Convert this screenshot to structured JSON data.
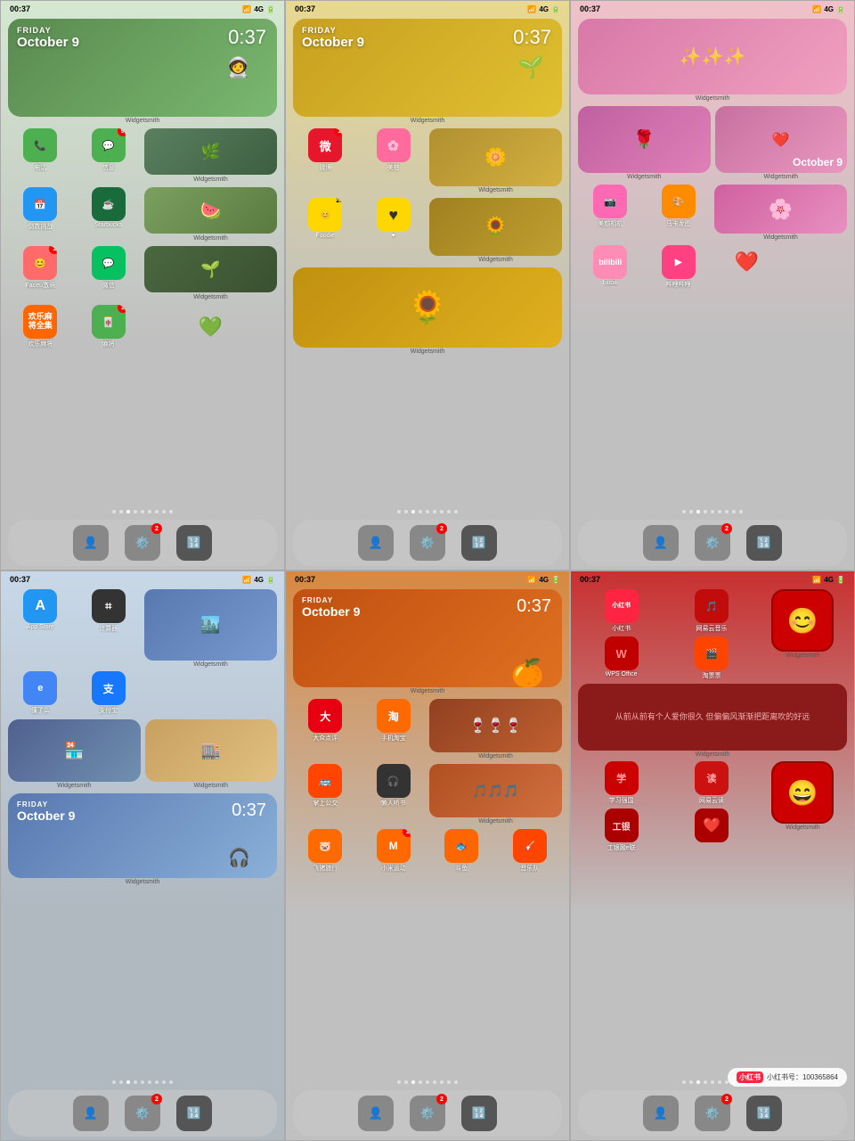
{
  "phones": [
    {
      "id": "phone-1",
      "theme": "green",
      "status": {
        "time": "00:37",
        "signal": "4G"
      },
      "widget_clock": "0:37",
      "widget_day": "FRIDAY",
      "widget_date": "October 9",
      "apps": [
        {
          "name": "电话",
          "bg": "#4CAF50",
          "icon": "📞",
          "badge": ""
        },
        {
          "name": "信息",
          "bg": "#4CAF50",
          "icon": "💬",
          "badge": "9"
        },
        {
          "name": "",
          "bg": "transparent",
          "icon": "",
          "badge": ""
        },
        {
          "name": "",
          "bg": "transparent",
          "icon": "",
          "badge": ""
        },
        {
          "name": "倒数挑战",
          "bg": "#2196F3",
          "icon": "📅",
          "badge": ""
        },
        {
          "name": "Starbucks",
          "bg": "#1a6b3c",
          "icon": "☕",
          "badge": ""
        },
        {
          "name": "",
          "bg": "transparent",
          "icon": "",
          "badge": ""
        },
        {
          "name": "",
          "bg": "transparent",
          "icon": "",
          "badge": ""
        },
        {
          "name": "Faceu激萌",
          "bg": "#FF6B6B",
          "icon": "😊",
          "badge": "1"
        },
        {
          "name": "微信",
          "bg": "#07C160",
          "icon": "💬",
          "badge": ""
        },
        {
          "name": "",
          "bg": "transparent",
          "icon": "",
          "badge": ""
        },
        {
          "name": "",
          "bg": "transparent",
          "icon": "",
          "badge": ""
        },
        {
          "name": "欢乐麻将",
          "bg": "#FF6600",
          "icon": "🀄",
          "badge": ""
        },
        {
          "name": "麻将",
          "bg": "#4CAF50",
          "icon": "🀄",
          "badge": "1"
        },
        {
          "name": "",
          "bg": "transparent",
          "icon": "",
          "badge": ""
        },
        {
          "name": "",
          "bg": "transparent",
          "icon": "",
          "badge": ""
        }
      ],
      "widgetsmith_labels": [
        "Widgetsmith",
        "Widgetsmith",
        "Widgetsmith"
      ],
      "dots": [
        false,
        false,
        true,
        false,
        false,
        false,
        false,
        false,
        false
      ],
      "dock": [
        {
          "icon": "👤",
          "bg": "#888",
          "badge": ""
        },
        {
          "icon": "⚙️",
          "bg": "#888",
          "badge": "2"
        },
        {
          "icon": "🔢",
          "bg": "#555",
          "badge": ""
        }
      ]
    },
    {
      "id": "phone-2",
      "theme": "yellow",
      "status": {
        "time": "00:37",
        "signal": "4G"
      },
      "widget_clock": "0:37",
      "widget_day": "FRIDAY",
      "widget_date": "October 9",
      "apps": [
        {
          "name": "微博",
          "bg": "#E6162D",
          "icon": "微",
          "badge": "1"
        },
        {
          "name": "美柚",
          "bg": "#FF6B9D",
          "icon": "🌸",
          "badge": ""
        },
        {
          "name": "",
          "bg": "transparent",
          "icon": "",
          "badge": ""
        },
        {
          "name": "",
          "bg": "transparent",
          "icon": "",
          "badge": ""
        },
        {
          "name": "Foodie",
          "bg": "#FFD700",
          "icon": "😊",
          "badge": ""
        },
        {
          "name": "♥",
          "bg": "#FFD700",
          "icon": "♥",
          "badge": "20"
        }
      ],
      "widgetsmith_labels": [
        "Widgetsmith",
        "Widgetsmith",
        "Widgetsmith"
      ],
      "dots": [
        false,
        false,
        true,
        false,
        false,
        false,
        false,
        false,
        false
      ],
      "dock": [
        {
          "icon": "👤",
          "bg": "#888",
          "badge": ""
        },
        {
          "icon": "⚙️",
          "bg": "#888",
          "badge": "2"
        },
        {
          "icon": "🔢",
          "bg": "#555",
          "badge": ""
        }
      ]
    },
    {
      "id": "phone-3",
      "theme": "pink",
      "status": {
        "time": "00:37",
        "signal": "4G"
      },
      "widget_clock": "",
      "widget_day": "",
      "widget_date": "October 9",
      "apps": [
        {
          "name": "美颜相机",
          "bg": "#FF69B4",
          "icon": "📷",
          "badge": ""
        },
        {
          "name": "马卡龙图",
          "bg": "#FF8C00",
          "icon": "🎨",
          "badge": ""
        },
        {
          "name": "bilibili",
          "bg": "#FF8CB4",
          "icon": "📺",
          "badge": ""
        },
        {
          "name": "哔哩哔哩",
          "bg": "#FF4081",
          "icon": "▶️",
          "badge": ""
        },
        {
          "name": "❤️",
          "bg": "#FF69B4",
          "icon": "❤️",
          "badge": ""
        }
      ],
      "widgetsmith_labels": [
        "Widgetsmith",
        "Widgetsmith",
        "Widgetsmith",
        "Widgetsmith"
      ],
      "dots": [
        false,
        false,
        true,
        false,
        false,
        false,
        false,
        false,
        false
      ],
      "dock": [
        {
          "icon": "👤",
          "bg": "#888",
          "badge": ""
        },
        {
          "icon": "⚙️",
          "bg": "#888",
          "badge": "2"
        },
        {
          "icon": "🔢",
          "bg": "#555",
          "badge": ""
        }
      ]
    },
    {
      "id": "phone-4",
      "theme": "blue",
      "status": {
        "time": "00:37",
        "signal": "4G"
      },
      "widget_clock": "0:37",
      "widget_day": "FRIDAY",
      "widget_date": "October 9",
      "apps": [
        {
          "name": "App Store",
          "bg": "#2196F3",
          "icon": "A",
          "badge": ""
        },
        {
          "name": "计算器",
          "bg": "#333",
          "icon": "⌗",
          "badge": ""
        },
        {
          "name": "",
          "bg": "transparent",
          "icon": "",
          "badge": ""
        },
        {
          "name": "懂了么",
          "bg": "#4285F4",
          "icon": "e",
          "badge": ""
        },
        {
          "name": "支付宝",
          "bg": "#1677FF",
          "icon": "支",
          "badge": ""
        },
        {
          "name": "",
          "bg": "transparent",
          "icon": "",
          "badge": ""
        }
      ],
      "widgetsmith_labels": [
        "Widgetsmith",
        "Widgetsmith",
        "Widgetsmith"
      ],
      "dots": [
        false,
        false,
        true,
        false,
        false,
        false,
        false,
        false,
        false
      ],
      "dock": [
        {
          "icon": "👤",
          "bg": "#888",
          "badge": ""
        },
        {
          "icon": "⚙️",
          "bg": "#888",
          "badge": "2"
        },
        {
          "icon": "🔢",
          "bg": "#555",
          "badge": ""
        }
      ]
    },
    {
      "id": "phone-5",
      "theme": "orange",
      "status": {
        "time": "00:37",
        "signal": "4G"
      },
      "widget_clock": "0:37",
      "widget_day": "FRIDAY",
      "widget_date": "October 9",
      "apps": [
        {
          "name": "大众点评",
          "bg": "#E60012",
          "icon": "大",
          "badge": ""
        },
        {
          "name": "手机淘宝",
          "bg": "#FF6A00",
          "icon": "淘",
          "badge": ""
        },
        {
          "name": "",
          "bg": "transparent",
          "icon": "",
          "badge": ""
        },
        {
          "name": "掌上公交",
          "bg": "#FF4500",
          "icon": "🚌",
          "badge": ""
        },
        {
          "name": "懒人听书",
          "bg": "#333",
          "icon": "🎧",
          "badge": ""
        },
        {
          "name": "",
          "bg": "transparent",
          "icon": "",
          "badge": ""
        },
        {
          "name": "飞猪旅行",
          "bg": "#FF6A00",
          "icon": "🐷",
          "badge": ""
        },
        {
          "name": "小米运动",
          "bg": "#FF6900",
          "icon": "M",
          "badge": "1"
        },
        {
          "name": "",
          "bg": "transparent",
          "icon": "",
          "badge": ""
        },
        {
          "name": "斗鱼",
          "bg": "#FF6600",
          "icon": "🐟",
          "badge": ""
        },
        {
          "name": "音乐队",
          "bg": "#FF4500",
          "icon": "🎸",
          "badge": ""
        }
      ],
      "widgetsmith_labels": [
        "Widgetsmith",
        "Widgetsmith",
        "Widgetsmith"
      ],
      "dots": [
        false,
        false,
        true,
        false,
        false,
        false,
        false,
        false,
        false
      ],
      "dock": [
        {
          "icon": "👤",
          "bg": "#888",
          "badge": ""
        },
        {
          "icon": "⚙️",
          "bg": "#888",
          "badge": "2"
        },
        {
          "icon": "🔢",
          "bg": "#555",
          "badge": ""
        }
      ]
    },
    {
      "id": "phone-6",
      "theme": "red",
      "status": {
        "time": "00:37",
        "signal": "4G"
      },
      "apps": [
        {
          "name": "小红书",
          "bg": "#FF2442",
          "icon": "小红书",
          "badge": ""
        },
        {
          "name": "网易云音乐",
          "bg": "#C20C0C",
          "icon": "🎵",
          "badge": ""
        },
        {
          "name": "cartoon1",
          "bg": "#CC0000",
          "icon": "😊",
          "badge": ""
        },
        {
          "name": "WPS Office",
          "bg": "#C00000",
          "icon": "W",
          "badge": ""
        },
        {
          "name": "淘票票",
          "bg": "#FF4400",
          "icon": "🎬",
          "badge": ""
        },
        {
          "name": "cartoon2",
          "bg": "#CC0000",
          "icon": "😊",
          "badge": ""
        },
        {
          "name": "学习强国",
          "bg": "#CC0000",
          "icon": "学",
          "badge": ""
        },
        {
          "name": "网易云读",
          "bg": "#CC1111",
          "icon": "读",
          "badge": ""
        },
        {
          "name": "cartoon3",
          "bg": "#CC0000",
          "icon": "😊",
          "badge": ""
        },
        {
          "name": "工银融e联",
          "bg": "#AA0000",
          "icon": "工",
          "badge": ""
        },
        {
          "name": "❤️",
          "bg": "#AA0000",
          "icon": "❤️",
          "badge": ""
        }
      ],
      "red_widget_text": "从前从前有个人爱你很久\n\n但偏偏风渐渐把距离吹的好远",
      "widgetsmith_labels": [
        "Widgetsmith",
        "Widgetsmith",
        "Widgetsmith"
      ],
      "dots": [
        false,
        false,
        true,
        false,
        false,
        false,
        false,
        false,
        false
      ],
      "watermark": "小红书号：100365864"
    }
  ],
  "ui": {
    "widgetsmith": "Widgetsmith"
  }
}
